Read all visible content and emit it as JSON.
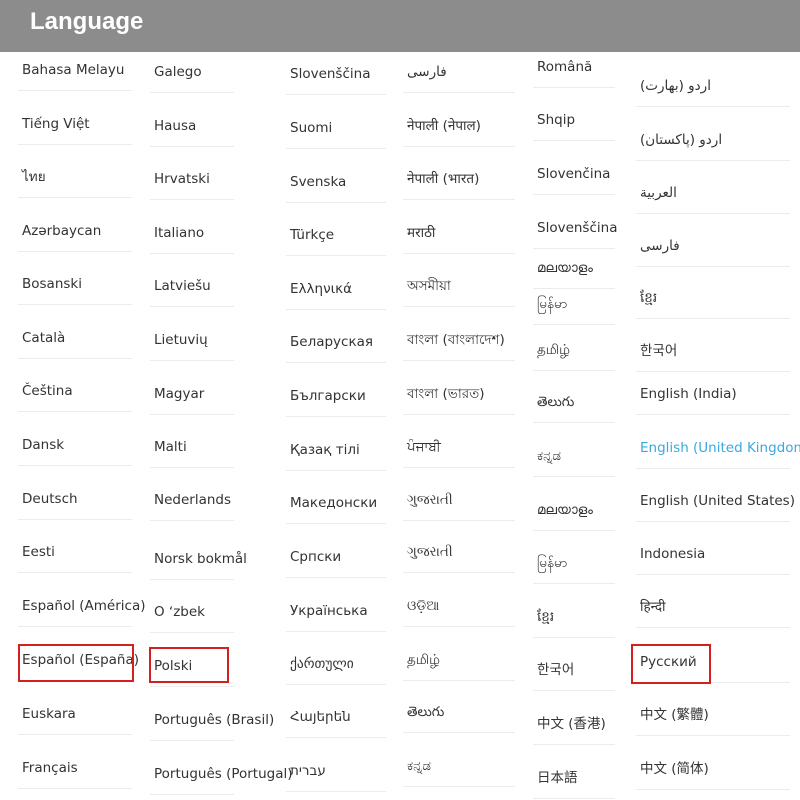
{
  "header": {
    "title": "Language"
  },
  "colors": {
    "header_bg": "#8c8c8c",
    "selected": "#3ba8e0",
    "highlight_box": "#d21f1f"
  },
  "columns": [
    [
      "Bahasa Melayu",
      "Tiếng Việt",
      "ไทย",
      "Azərbaycan",
      "Bosanski",
      "Català",
      "Čeština",
      "Dansk",
      "Deutsch",
      "Eesti",
      "Español (América)",
      "Español (España)",
      "Euskara",
      "Français"
    ],
    [
      "Galego",
      "Hausa",
      "Hrvatski",
      "Italiano",
      "Latviešu",
      "Lietuvių",
      "Magyar",
      "Malti",
      "Nederlands",
      "Norsk bokmål",
      "O ʻzbek",
      "Polski",
      "Português (Brasil)",
      "Português (Portugal)"
    ],
    [
      "Slovenščina",
      "Suomi",
      "Svenska",
      "Türkçe",
      "Ελληνικά",
      "Беларуская",
      "Български",
      "Қазақ тілі",
      "Македонски",
      "Српски",
      "Українська",
      "ქართული",
      "Հայերեն",
      "עברית"
    ],
    [
      "فارسی",
      "नेपाली (नेपाल)",
      "नेपाली (भारत)",
      "मराठी",
      "অসমীয়া",
      "বাংলা (বাংলাদেশ)",
      "বাংলা (ভারত)",
      "ਪੰਜਾਬੀ",
      "ગુજરાતી",
      "ગુજરાતી",
      "ଓଡ଼ିଆ",
      "தமிழ்",
      "తెలుగు",
      "ಕನ್ನಡ"
    ],
    [
      "Română",
      "Shqip",
      "Slovenčina",
      "Slovenščina",
      "മലയാളം",
      "မြန်မာ",
      "தமிழ்",
      "తెలుగు",
      "ಕನ್ನಡ",
      "മലയാളം",
      "မြန်မာ",
      "ខ្មែរ",
      "한국어",
      "中文 (香港)",
      "日本語"
    ],
    [
      "اردو (بھارت)",
      "اردو (پاکستان)",
      "العربية",
      "فارسی",
      "ខ្មែរ",
      "한국어",
      "English (India)",
      "English (United Kingdom)",
      "English (United States)",
      "Indonesia",
      "हिन्दी",
      "Русский",
      "中文 (繁體)",
      "中文 (简体)"
    ]
  ],
  "selected_language": "English (United Kingdom)"
}
